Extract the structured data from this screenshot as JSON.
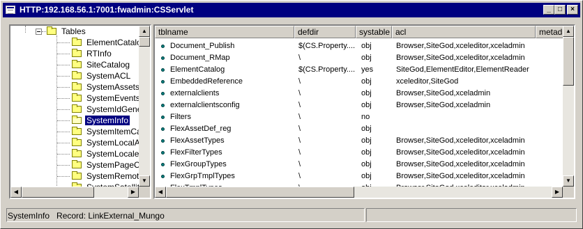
{
  "window": {
    "title": "HTTP:192.168.56.1:7001:fwadmin:CSServlet",
    "buttons": {
      "minimize": "_",
      "maximize": "□",
      "close": "×"
    }
  },
  "tree": {
    "root_label": "Tables",
    "items": [
      {
        "label": "ElementCatalog",
        "selected": false
      },
      {
        "label": "RTInfo",
        "selected": false
      },
      {
        "label": "SiteCatalog",
        "selected": false
      },
      {
        "label": "SystemACL",
        "selected": false
      },
      {
        "label": "SystemAssets",
        "selected": false
      },
      {
        "label": "SystemEvents",
        "selected": false
      },
      {
        "label": "SystemIdGenera",
        "selected": false
      },
      {
        "label": "SystemInfo",
        "selected": true
      },
      {
        "label": "SystemItemCacl",
        "selected": false
      },
      {
        "label": "SystemLocalAlia",
        "selected": false
      },
      {
        "label": "SystemLocaleSt",
        "selected": false
      },
      {
        "label": "SystemPageCac",
        "selected": false
      },
      {
        "label": "SystemRemoteA",
        "selected": false
      },
      {
        "label": "SystemSatellite",
        "selected": false
      }
    ]
  },
  "table": {
    "columns": [
      "tblname",
      "defdir",
      "systable",
      "acl",
      "metada"
    ],
    "rows": [
      {
        "tblname": "Document_Publish",
        "defdir": "$(CS.Property....",
        "systable": "obj",
        "acl": "Browser,SiteGod,xceleditor,xceladmin"
      },
      {
        "tblname": "Document_RMap",
        "defdir": "\\",
        "systable": "obj",
        "acl": "Browser,SiteGod,xceleditor,xceladmin"
      },
      {
        "tblname": "ElementCatalog",
        "defdir": "$(CS.Property....",
        "systable": "yes",
        "acl": "SiteGod,ElementEditor,ElementReader"
      },
      {
        "tblname": "EmbeddedReference",
        "defdir": "\\",
        "systable": "obj",
        "acl": "xceleditor,SiteGod"
      },
      {
        "tblname": "externalclients",
        "defdir": "\\",
        "systable": "obj",
        "acl": "Browser,SiteGod,xceladmin"
      },
      {
        "tblname": "externalclientsconfig",
        "defdir": "\\",
        "systable": "obj",
        "acl": "Browser,SiteGod,xceladmin"
      },
      {
        "tblname": "Filters",
        "defdir": "\\",
        "systable": "no",
        "acl": ""
      },
      {
        "tblname": "FlexAssetDef_reg",
        "defdir": "\\",
        "systable": "obj",
        "acl": ""
      },
      {
        "tblname": "FlexAssetTypes",
        "defdir": "\\",
        "systable": "obj",
        "acl": "Browser,SiteGod,xceleditor,xceladmin"
      },
      {
        "tblname": "FlexFilterTypes",
        "defdir": "\\",
        "systable": "obj",
        "acl": "Browser,SiteGod,xceleditor,xceladmin"
      },
      {
        "tblname": "FlexGroupTypes",
        "defdir": "\\",
        "systable": "obj",
        "acl": "Browser,SiteGod,xceleditor,xceladmin"
      },
      {
        "tblname": "FlexGrpTmplTypes",
        "defdir": "\\",
        "systable": "obj",
        "acl": "Browser,SiteGod,xceleditor,xceladmin"
      },
      {
        "tblname": "FlexTmplTypes",
        "defdir": "\\",
        "systable": "obj",
        "acl": "Browser,SiteGod,xceleditor,xceladmin"
      }
    ]
  },
  "status": {
    "text": "SystemInfo   Record: LinkExternal_Mungo"
  },
  "colors": {
    "titlebar": "#000080",
    "selection": "#000080",
    "row_dot": "#008080"
  }
}
